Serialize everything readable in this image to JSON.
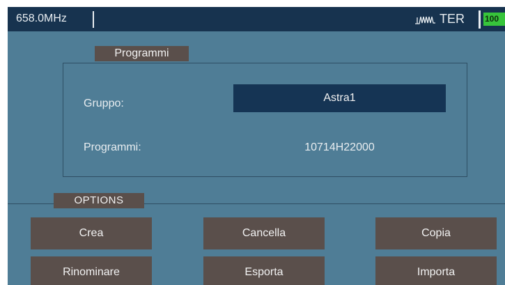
{
  "status_bar": {
    "frequency": "658.0MHz",
    "mode": "TER",
    "level": "100",
    "signal_icon": "antenna-signal-icon"
  },
  "programmi": {
    "section_title": "Programmi",
    "group_label": "Gruppo:",
    "group_value": "Astra1",
    "program_label": "Programmi:",
    "program_value": "10714H22000"
  },
  "options": {
    "section_title": "OPTIONS",
    "buttons": {
      "crea": "Crea",
      "cancella": "Cancella",
      "copia": "Copia",
      "rinominare": "Rinominare",
      "esporta": "Esporta",
      "importa": "Importa"
    }
  },
  "colors": {
    "background": "#4f7d96",
    "top_bar": "#17334f",
    "selected_field": "#153454",
    "button": "#5a4f4b",
    "level_indicator": "#37c43b"
  }
}
